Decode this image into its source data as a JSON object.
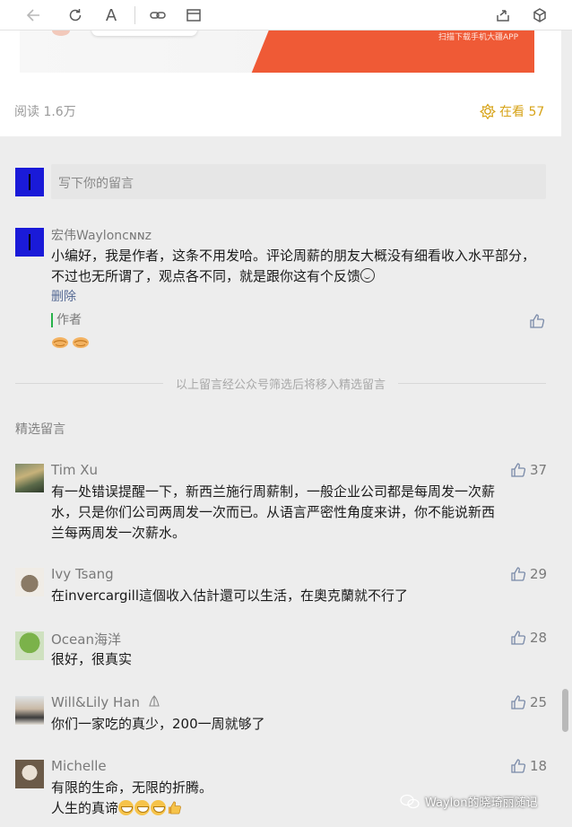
{
  "toolbar": {
    "icons": [
      "back-arrow-icon",
      "refresh-icon",
      "font-icon",
      "link-icon",
      "window-icon",
      "share-icon",
      "cube-icon"
    ],
    "font_glyph": "A"
  },
  "article": {
    "banner_caption": "扫描下载手机大疆APP",
    "read_label": "阅读 1.6万",
    "watching_label": "在看 57",
    "watching_color": "#d7a318"
  },
  "comment_input": {
    "placeholder": "写下你的留言"
  },
  "author_comment": {
    "name": "宏伟Waylonᴄɴɴᴢ",
    "text": "小编好，我是作者，这条不用发哈。评论周薪的朋友大概没有细看收入水平部分，不过也无所谓了，观点各不同，就是跟你这有个反馈",
    "delete_label": "删除",
    "author_badge": "作者",
    "badge_color": "#27b24a"
  },
  "divider_text": "以上留言经公众号筛选后将移入精选留言",
  "featured_title": "精选留言",
  "comments": [
    {
      "name": "Tim Xu",
      "likes": "37",
      "lines": [
        "有一处错误提醒一下，新西兰施行周薪制，一般企业公司都是每周发一次薪",
        "水，只是你们公司两周发一次而已。从语言严密性角度来讲，你不能说新西",
        "兰每两周发一次薪水。"
      ]
    },
    {
      "name": "Ivy Tsang",
      "likes": "29",
      "lines": [
        "在invercargill這個收入估計還可以生活，在奧克蘭就不行了"
      ]
    },
    {
      "name": "Ocean海洋",
      "likes": "28",
      "lines": [
        "很好，很真实"
      ]
    },
    {
      "name": "Will&Lily Han",
      "likes": "25",
      "lines": [
        "你们一家吃的真少，200一周就够了"
      ]
    },
    {
      "name": "Michelle",
      "likes": "18",
      "lines": [
        "有限的生命，无限的折腾。",
        "人生的真谛"
      ]
    }
  ],
  "watermark": "Waylon的晓琦丽随记",
  "link_color": "#576b95"
}
